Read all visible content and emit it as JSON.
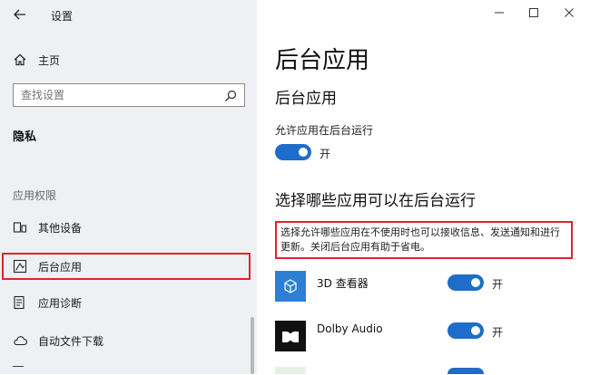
{
  "window": {
    "title": "设置",
    "minimize_icon": "minimize-icon",
    "maximize_icon": "maximize-icon",
    "close_icon": "close-icon"
  },
  "sidebar": {
    "home_label": "主页",
    "search_placeholder": "查找设置",
    "section_title": "隐私",
    "group_label": "应用权限",
    "items": [
      {
        "label": "其他设备",
        "icon": "devices-icon"
      },
      {
        "label": "后台应用",
        "icon": "background-apps-icon",
        "selected": true
      },
      {
        "label": "应用诊断",
        "icon": "diagnostics-icon"
      },
      {
        "label": "自动文件下载",
        "icon": "cloud-download-icon"
      }
    ]
  },
  "main": {
    "page_title": "后台应用",
    "section1_title": "后台应用",
    "allow_label": "允许应用在后台运行",
    "allow_toggle": {
      "state": "开",
      "on": true
    },
    "section2_title": "选择哪些应用可以在后台运行",
    "description": "选择允许哪些应用在不使用时也可以接收信息、发送通知和进行更新。关闭后台应用有助于省电。",
    "apps": [
      {
        "name": "3D 查看器",
        "toggle": "开",
        "on": true,
        "tile_color": "#2b7fd4",
        "icon": "cube-icon"
      },
      {
        "name": "Dolby Audio",
        "toggle": "开",
        "on": true,
        "tile_color": "#111111",
        "icon": "dolby-icon"
      }
    ]
  },
  "colors": {
    "accent": "#1e6ccb",
    "highlight_border": "#e0242d",
    "sidebar_bg": "#eef0f3"
  }
}
